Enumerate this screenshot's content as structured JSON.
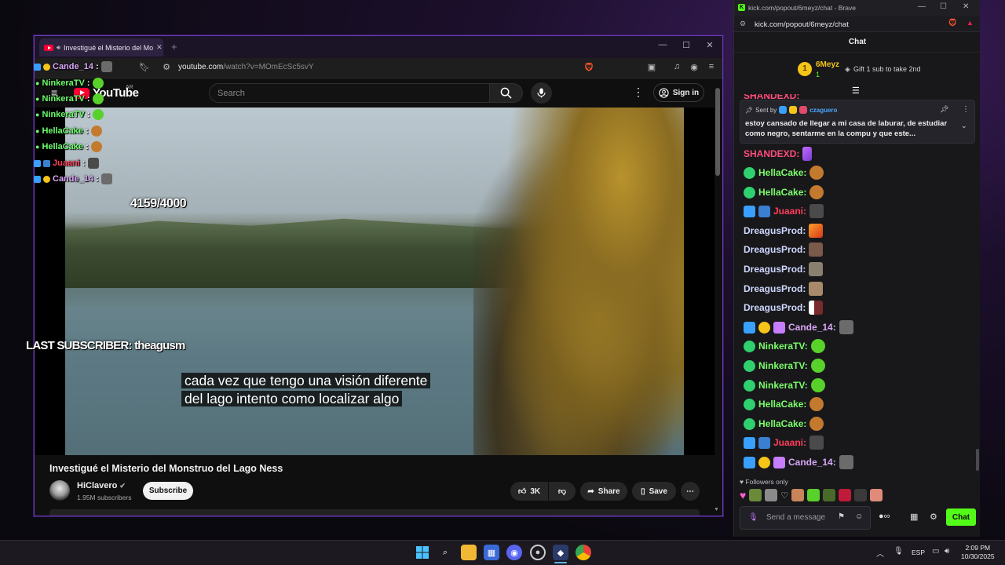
{
  "browser_left": {
    "tab_title": "Investigué el Misterio del Mo",
    "url_host": "youtube.com",
    "url_path": "/watch?v=MOmEcSc5svY"
  },
  "youtube": {
    "logo_text": "YouTube",
    "country_code": "AR",
    "search_placeholder": "Search",
    "signin_label": "Sign in",
    "caption_line1": "cada vez que tengo una visión diferente",
    "caption_line2": "del lago intento como localizar algo",
    "video_title": "Investigué el Misterio del Monstruo del Lago Ness",
    "channel_name": "HiClavero",
    "subscriber_count": "1.95M subscribers",
    "subscribe_label": "Subscribe",
    "likes": "3K",
    "share_label": "Share",
    "save_label": "Save"
  },
  "overlay": {
    "goal_count": "4159/4000",
    "last_subscriber": "LAST SUBSCRIBER: theagusm",
    "chat": [
      {
        "user": "Cande_14",
        "color": "#d9a7f7"
      },
      {
        "user": "NinkeraTV",
        "color": "#6bff6b"
      },
      {
        "user": "NinkeraTV",
        "color": "#6bff6b"
      },
      {
        "user": "NinkeraTV",
        "color": "#6bff6b"
      },
      {
        "user": "HellaCake",
        "color": "#6bff6b"
      },
      {
        "user": "HellaCake",
        "color": "#6bff6b"
      },
      {
        "user": "Juaani",
        "color": "#ff3d5a"
      },
      {
        "user": "Cande_14",
        "color": "#d9a7f7"
      }
    ]
  },
  "kick": {
    "window_title": "kick.com/popout/6meyz/chat - Brave",
    "url": "kick.com/popout/6meyz/chat",
    "header": "Chat",
    "gifter_name": "6Meyz",
    "gifter_count": "1",
    "gift_text": "Gift 1 sub to take 2nd",
    "pinned_sender_prefix": "Sent by",
    "pinned_sender": "czaguero",
    "pinned_message": "estoy cansado de llegar a mi casa de laburar, de estudiar como negro, sentarme en la compu y que este...",
    "partial_user": "SHANDEXD:",
    "messages": [
      {
        "user": "SHANDEXD:",
        "color": "#ff4d7a"
      },
      {
        "user": "HellaCake:",
        "color": "#7cff6b"
      },
      {
        "user": "HellaCake:",
        "color": "#7cff6b"
      },
      {
        "user": "Juaani:",
        "color": "#ff3d5a"
      },
      {
        "user": "DreagusProd:",
        "color": "#cfd8ff"
      },
      {
        "user": "DreagusProd:",
        "color": "#cfd8ff"
      },
      {
        "user": "DreagusProd:",
        "color": "#cfd8ff"
      },
      {
        "user": "DreagusProd:",
        "color": "#cfd8ff"
      },
      {
        "user": "DreagusProd:",
        "color": "#cfd8ff"
      },
      {
        "user": "Cande_14:",
        "color": "#d9a7f7"
      },
      {
        "user": "NinkeraTV:",
        "color": "#7cff6b"
      },
      {
        "user": "NinkeraTV:",
        "color": "#7cff6b"
      },
      {
        "user": "NinkeraTV:",
        "color": "#7cff6b"
      },
      {
        "user": "HellaCake:",
        "color": "#7cff6b"
      },
      {
        "user": "HellaCake:",
        "color": "#7cff6b"
      },
      {
        "user": "Juaani:",
        "color": "#ff3d5a"
      },
      {
        "user": "Cande_14:",
        "color": "#d9a7f7"
      }
    ],
    "followers_only": "Followers only",
    "input_placeholder": "Send a message",
    "chat_button": "Chat"
  },
  "taskbar": {
    "language": "ESP",
    "time": "2:09 PM",
    "date": "10/30/2025"
  }
}
